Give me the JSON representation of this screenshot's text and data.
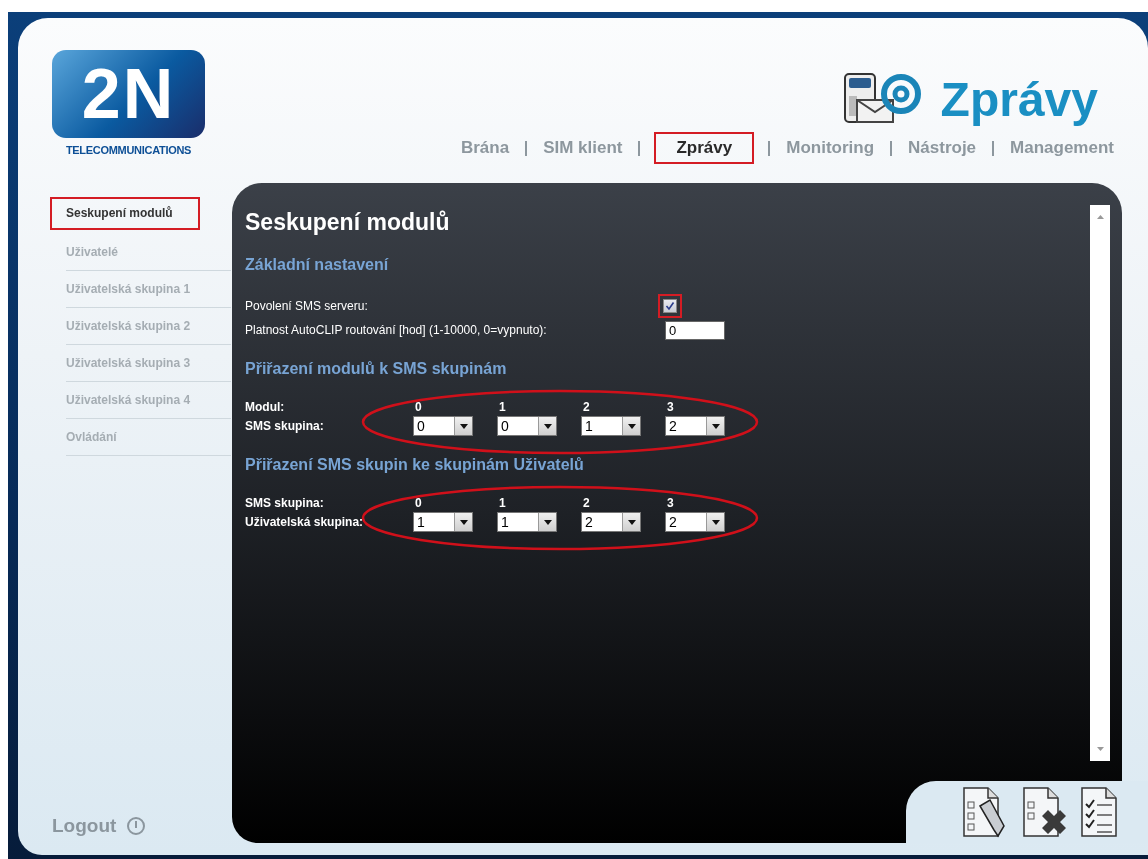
{
  "logo": {
    "mark": "2N",
    "tagline": "TELECOMMUNICATIONS"
  },
  "header": {
    "title": "Zprávy"
  },
  "nav": [
    {
      "label": "Brána",
      "selected": false
    },
    {
      "label": "SIM klient",
      "selected": false
    },
    {
      "label": "Zprávy",
      "selected": true
    },
    {
      "label": "Monitoring",
      "selected": false
    },
    {
      "label": "Nástroje",
      "selected": false
    },
    {
      "label": "Management",
      "selected": false
    }
  ],
  "sidebar": {
    "items": [
      {
        "label": "Seskupení modulů",
        "selected": true
      },
      {
        "label": "Uživatelé",
        "selected": false
      },
      {
        "label": "Uživatelská skupina 1",
        "selected": false
      },
      {
        "label": "Uživatelská skupina 2",
        "selected": false
      },
      {
        "label": "Uživatelská skupina 3",
        "selected": false
      },
      {
        "label": "Uživatelská skupina 4",
        "selected": false
      },
      {
        "label": "Ovládání",
        "selected": false
      }
    ],
    "logout": "Logout"
  },
  "content": {
    "title": "Seskupení modulů",
    "sections": [
      {
        "kind": "settings",
        "heading": "Základní nastavení",
        "rows": [
          {
            "kind": "checkbox",
            "label": "Povolení SMS serveru:",
            "checked": true,
            "highlighted": true
          },
          {
            "kind": "text",
            "label": "Platnost AutoCLIP routování [hod] (1-10000, 0=vypnuto):",
            "value": "0"
          }
        ]
      },
      {
        "kind": "grid",
        "heading": "Přiřazení modulů k SMS skupinám",
        "highlighted": true,
        "header_label": "Modul:",
        "columns": [
          "0",
          "1",
          "2",
          "3"
        ],
        "row_label": "SMS skupina:",
        "values": [
          "0",
          "0",
          "1",
          "2"
        ]
      },
      {
        "kind": "grid",
        "heading": "Přiřazení SMS skupin ke skupinám Uživatelů",
        "highlighted": true,
        "header_label": "SMS skupina:",
        "columns": [
          "0",
          "1",
          "2",
          "3"
        ],
        "row_label": "Uživatelská skupina:",
        "values": [
          "1",
          "1",
          "2",
          "2"
        ]
      }
    ]
  }
}
